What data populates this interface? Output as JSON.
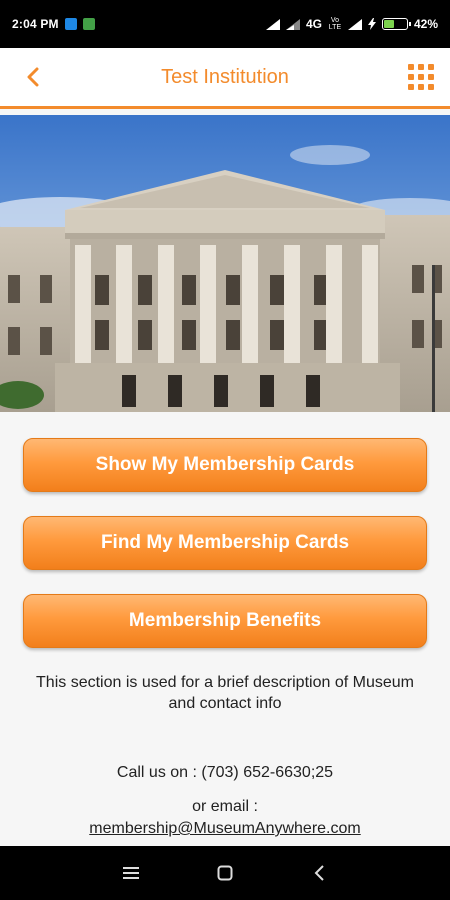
{
  "status_bar": {
    "time": "2:04 PM",
    "network": "4G",
    "volte": "Vo LTE",
    "battery_percent": "42%",
    "battery_level": 0.42
  },
  "header": {
    "title": "Test Institution"
  },
  "buttons": {
    "show_cards": "Show My Membership Cards",
    "find_cards": "Find My Membership Cards",
    "benefits": "Membership Benefits"
  },
  "description": "This section is used for a brief description of Museum and contact info",
  "contact": {
    "call": "Call us on : (703) 652-6630;25",
    "or_email": "or email :",
    "email": "membership@MuseumAnywhere.com"
  },
  "colors": {
    "accent": "#f38b2c"
  },
  "icons": {
    "back": "chevron-left-icon",
    "menu": "grid-menu-icon",
    "nav_recent": "menu-lines-icon",
    "nav_home": "square-home-icon",
    "nav_back": "triangle-back-icon"
  }
}
